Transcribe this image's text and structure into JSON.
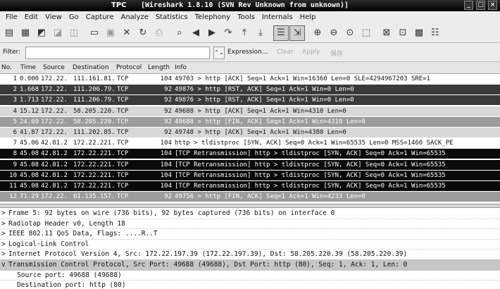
{
  "window": {
    "app_name": "TPC",
    "title": "[Wireshark 1.8.10  (SVN Rev Unknown from unknown)]"
  },
  "menu": [
    "File",
    "Edit",
    "View",
    "Go",
    "Capture",
    "Analyze",
    "Statistics",
    "Telephony",
    "Tools",
    "Internals",
    "Help"
  ],
  "filter": {
    "label": "Filter:",
    "value": "",
    "expression_label": "Expression...",
    "clear_label": "Clear",
    "apply_label": "Apply",
    "save_label": "保存"
  },
  "columns": [
    "No.",
    "Time",
    "Source",
    "Destination",
    "Protocol",
    "Length",
    "Info"
  ],
  "packets": [
    {
      "no": "1",
      "time": "0.000",
      "src": "172.22.",
      "dst": "111.161.81.",
      "proto": "TCP",
      "len": "104",
      "info": "49703 > http [ACK] Seq=1 Ack=1 Win=16360 Len=0 SLE=4294967203 SRE=1",
      "bg": "#ffffff",
      "fg": "#111111"
    },
    {
      "no": "2",
      "time": "1.668",
      "src": "172.22.",
      "dst": "111.206.79.",
      "proto": "TCP",
      "len": "92",
      "info": "49876 > http [RST, ACK] Seq=1 Ack=1 Win=0 Len=0",
      "bg": "#3a3a3a",
      "fg": "#ffffff"
    },
    {
      "no": "3",
      "time": "1.713",
      "src": "172.22.",
      "dst": "111.206.79.",
      "proto": "TCP",
      "len": "92",
      "info": "49876 > http [RST, ACK] Seq=1 Ack=1 Win=0 Len=0",
      "bg": "#3a3a3a",
      "fg": "#ffffff"
    },
    {
      "no": "4",
      "time": "15.12",
      "src": "172.22.",
      "dst": "58.205.220.",
      "proto": "TCP",
      "len": "92",
      "info": "49688 > http [ACK] Seq=1 Ack=1 Win=4310 Len=0",
      "bg": "#d8d8d8",
      "fg": "#111111"
    },
    {
      "no": "5",
      "time": "24.69",
      "src": "172.22.",
      "dst": "58.205.220.",
      "proto": "TCP",
      "len": "92",
      "info": "49688 > http [FIN, ACK] Seq=1 Ack=1 Win=4310 Len=0",
      "bg": "#9c9c9c",
      "fg": "#ffffff"
    },
    {
      "no": "6",
      "time": "41.87",
      "src": "172.22.",
      "dst": "111.202.85.",
      "proto": "TCP",
      "len": "92",
      "info": "49748 > http [ACK] Seq=1 Ack=1 Win=4380 Len=0",
      "bg": "#d8d8d8",
      "fg": "#111111"
    },
    {
      "no": "7",
      "time": "45.06",
      "src": "42.81.2",
      "dst": "172.22.221.",
      "proto": "TCP",
      "len": "104",
      "info": "http > tldistproc [SYN, ACK] Seq=0 Ack=1 Win=65535 Len=0 MSS=1460 SACK_PE",
      "bg": "#ffffff",
      "fg": "#111111"
    },
    {
      "no": "8",
      "time": "45.08",
      "src": "42.81.2",
      "dst": "172.22.221.",
      "proto": "TCP",
      "len": "104",
      "info": "[TCP Retransmission] http > tldistproc [SYN, ACK] Seq=0 Ack=1 Win=65535",
      "bg": "#0a0a0a",
      "fg": "#ffffff"
    },
    {
      "no": "9",
      "time": "45.08",
      "src": "42.81.2",
      "dst": "172.22.221.",
      "proto": "TCP",
      "len": "104",
      "info": "[TCP Retransmission] http > tldistproc [SYN, ACK] Seq=0 Ack=1 Win=65535",
      "bg": "#0a0a0a",
      "fg": "#ffffff"
    },
    {
      "no": "10",
      "time": "45.08",
      "src": "42.81.2",
      "dst": "172.22.221.",
      "proto": "TCP",
      "len": "104",
      "info": "[TCP Retransmission] http > tldistproc [SYN, ACK] Seq=0 Ack=1 Win=65535",
      "bg": "#0a0a0a",
      "fg": "#ffffff"
    },
    {
      "no": "11",
      "time": "45.08",
      "src": "42.81.2",
      "dst": "172.22.221.",
      "proto": "TCP",
      "len": "104",
      "info": "[TCP Retransmission] http > tldistproc [SYN, ACK] Seq=0 Ack=1 Win=65535",
      "bg": "#0a0a0a",
      "fg": "#ffffff"
    },
    {
      "no": "12",
      "time": "71.29",
      "src": "172.22.",
      "dst": "61.135.157.",
      "proto": "TCP",
      "len": "92",
      "info": "49756 > http [FIN, ACK] Seq=1 Ack=1 Win=4233 Len=0",
      "bg": "#9c9c9c",
      "fg": "#ffffff"
    }
  ],
  "details": [
    {
      "twisty": ">",
      "text": "Frame 5: 92 bytes on wire (736 bits), 92 bytes captured (736 bits) on interface 0",
      "level": 0,
      "selected": false
    },
    {
      "twisty": ">",
      "text": "Radiotap Header v0, Length 18",
      "level": 0,
      "selected": false
    },
    {
      "twisty": ">",
      "text": "IEEE 802.11 QoS Data, Flags: ....R..T",
      "level": 0,
      "selected": false
    },
    {
      "twisty": ">",
      "text": "Logical-Link Control",
      "level": 0,
      "selected": false
    },
    {
      "twisty": ">",
      "text": "Internet Protocol Version 4, Src: 172.22.197.39 (172.22.197.39), Dst: 58.205.220.39 (58.205.220.39)",
      "level": 0,
      "selected": false
    },
    {
      "twisty": "v",
      "text": "Transmission Control Protocol, Src Port: 49688 (49688), Dst Port: http (80), Seq: 1, Ack: 1, Len: 0",
      "level": 0,
      "selected": true
    },
    {
      "twisty": "",
      "text": "Source port: 49688 (49688)",
      "level": 1,
      "selected": false
    },
    {
      "twisty": "",
      "text": "Destination port: http (80)",
      "level": 1,
      "selected": false
    }
  ]
}
